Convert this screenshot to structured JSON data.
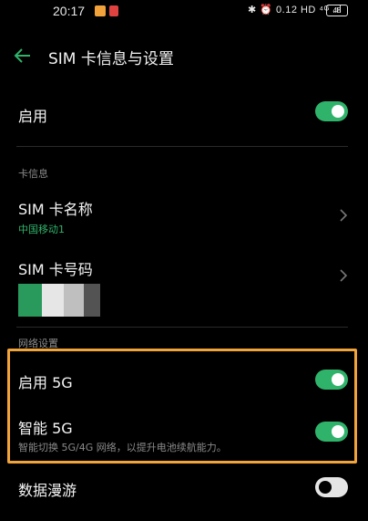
{
  "status_bar": {
    "time": "20:17",
    "icons_text": "✱ ⏰ 0.12 HD ⁴ᴳ .ıl",
    "battery": "48"
  },
  "header": {
    "back_icon": "arrow-left-icon",
    "title": "SIM 卡信息与设置"
  },
  "enable_row": {
    "label": "启用",
    "toggle_on": true
  },
  "card_info": {
    "section_label": "卡信息",
    "sim_name": {
      "label": "SIM 卡名称",
      "value": "中国移动1"
    },
    "sim_number": {
      "label": "SIM 卡号码"
    }
  },
  "network": {
    "section_label": "网络设置",
    "enable_5g": {
      "label": "启用 5G",
      "toggle_on": true
    },
    "smart_5g": {
      "label": "智能 5G",
      "description": "智能切换 5G/4G 网络，以提升电池续航能力。",
      "toggle_on": true
    },
    "roaming": {
      "label": "数据漫游",
      "toggle_on": false
    }
  },
  "colors": {
    "accent_green": "#2fb36b",
    "highlight_orange": "#f1a43a",
    "background": "#000000"
  }
}
